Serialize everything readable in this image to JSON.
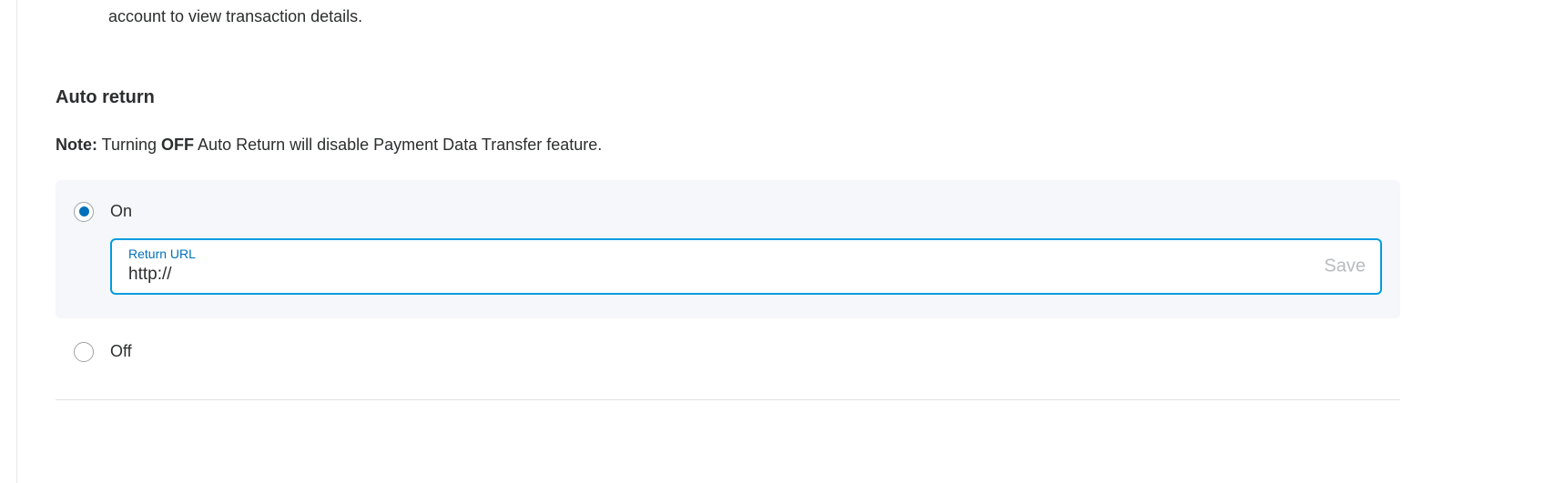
{
  "fragment_text": "account to view transaction details.",
  "section": {
    "title": "Auto return",
    "note_label": "Note:",
    "note_pre": " Turning ",
    "note_bold": "OFF",
    "note_post": " Auto Return will disable Payment Data Transfer feature."
  },
  "radio": {
    "on_label": "On",
    "off_label": "Off"
  },
  "input": {
    "float_label": "Return URL",
    "value": "http://",
    "save_label": "Save"
  }
}
